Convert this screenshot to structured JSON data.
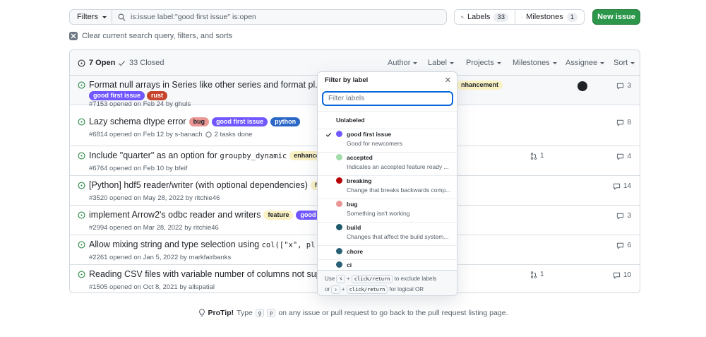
{
  "toolbar": {
    "filters_label": "Filters",
    "search_value": "is:issue label:\"good first issue\" is:open",
    "labels_label": "Labels",
    "labels_count": "33",
    "milestones_label": "Milestones",
    "milestones_count": "1",
    "new_issue_label": "New issue",
    "clear_label": "Clear current search query, filters, and sorts"
  },
  "list_header": {
    "open_label": "7 Open",
    "closed_label": "33 Closed",
    "filters": [
      "Author",
      "Label",
      "Projects",
      "Milestones",
      "Assignee",
      "Sort"
    ]
  },
  "issues": [
    {
      "title": "Format null arrays in Series like other series and format pl.List(pl",
      "meta": "#7153 opened on Feb 24 by ghuls",
      "comments": "3",
      "labels_line2": [
        {
          "text": "good first issue",
          "bg": "#7057ff",
          "fg": "#ffffff"
        },
        {
          "text": "rust",
          "bg": "#dea584",
          "fg": "#1f2328",
          "darkbg": "#c5442b"
        }
      ],
      "extra_label": "nhancement"
    },
    {
      "title": "Lazy schema dtype error",
      "meta": "#6814 opened on Feb 12 by s-banach",
      "tasks": "2 tasks done",
      "comments": "8"
    },
    {
      "title_pre": "Include \"quarter\" as an option for",
      "title_code": "groupby_dynamic",
      "meta": "#6764 opened on Feb 10 by bfeif",
      "label_after": "enhancemen",
      "pr": "1",
      "comments": "4"
    },
    {
      "title": "[Python] hdf5 reader/writer (with optional dependencies)",
      "meta": "#3520 opened on May 28, 2022 by ritchie46",
      "label_after": "feature",
      "comments": "14"
    },
    {
      "title": "implement Arrow2's odbc reader and writers",
      "meta": "#2994 opened on Mar 28, 2022 by ritchie46",
      "label_after": "feature",
      "label_after2": "good first iss",
      "comments": "3"
    },
    {
      "title_pre": "Allow mixing string and type selection using",
      "title_code": "col([\"x\", pl.Int6",
      "meta": "#2261 opened on Jan 5, 2022 by markfairbanks",
      "comments": "6"
    },
    {
      "title": "Reading CSV files with variable number of columns not supporte",
      "meta": "#1505 opened on Oct 8, 2021 by allspatial",
      "pr": "1",
      "comments": "10"
    }
  ],
  "issue2_labels": [
    {
      "text": "bug",
      "bg": "#e99695",
      "fg": "#1f2328"
    },
    {
      "text": "good first issue",
      "bg": "#7057ff",
      "fg": "#ffffff"
    },
    {
      "text": "python",
      "bg": "#2b67c6",
      "fg": "#ffffff"
    }
  ],
  "dropdown": {
    "title": "Filter by label",
    "placeholder": "Filter labels",
    "unlabeled": "Unlabeled",
    "items": [
      {
        "name": "good first issue",
        "desc": "Good for newcomers",
        "color": "#7057ff",
        "checked": true
      },
      {
        "name": "accepted",
        "desc": "Indicates an accepted feature ready ...",
        "color": "#a2dcaa"
      },
      {
        "name": "breaking",
        "desc": "Change that breaks backwards comp...",
        "color": "#b60205"
      },
      {
        "name": "bug",
        "desc": "Something isn't working",
        "color": "#e99695"
      },
      {
        "name": "build",
        "desc": "Changes that affect the build system...",
        "color": "#1d5b6a"
      },
      {
        "name": "chore",
        "desc": "",
        "color": "#2a6075"
      },
      {
        "name": "ci",
        "desc": "",
        "color": "#2a6075"
      }
    ],
    "footer_use": "Use",
    "footer_key1": "⌥",
    "footer_plus": "+",
    "footer_click": "click/return",
    "footer_exclude": "to exclude labels",
    "footer_or": "or",
    "footer_key2": "⇧",
    "footer_logical": "for logical OR"
  },
  "protip": {
    "label": "ProTip!",
    "text1": "Type",
    "key1": "g",
    "key2": "p",
    "text2": "on any issue or pull request to go back to the pull request listing page."
  },
  "colors": {
    "accent_green": "#2c974b",
    "focus_blue": "#0969da",
    "open_green": "#1a7f37"
  }
}
